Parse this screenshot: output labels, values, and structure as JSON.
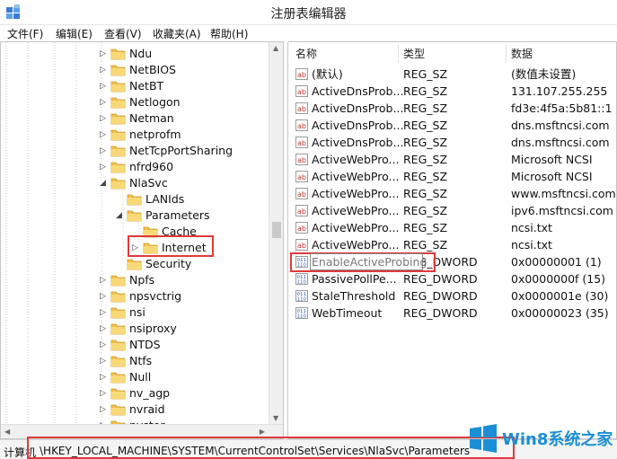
{
  "window": {
    "title": "注册表编辑器"
  },
  "menu": [
    {
      "label": "文件(F)"
    },
    {
      "label": "编辑(E)"
    },
    {
      "label": "查看(V)"
    },
    {
      "label": "收藏夹(A)"
    },
    {
      "label": "帮助(H)"
    }
  ],
  "tree": {
    "nodes": [
      {
        "label": "Ndu",
        "level": 0,
        "expander": "▷"
      },
      {
        "label": "NetBIOS",
        "level": 0,
        "expander": "▷"
      },
      {
        "label": "NetBT",
        "level": 0,
        "expander": "▷"
      },
      {
        "label": "Netlogon",
        "level": 0,
        "expander": "▷"
      },
      {
        "label": "Netman",
        "level": 0,
        "expander": "▷"
      },
      {
        "label": "netprofm",
        "level": 0,
        "expander": "▷"
      },
      {
        "label": "NetTcpPortSharing",
        "level": 0,
        "expander": "▷"
      },
      {
        "label": "nfrd960",
        "level": 0,
        "expander": "▷"
      },
      {
        "label": "NlaSvc",
        "level": 0,
        "expander": "◢"
      },
      {
        "label": "LANIds",
        "level": 1,
        "expander": ""
      },
      {
        "label": "Parameters",
        "level": 1,
        "expander": "◢"
      },
      {
        "label": "Cache",
        "level": 2,
        "expander": ""
      },
      {
        "label": "Internet",
        "level": 2,
        "expander": "▷",
        "selected": true
      },
      {
        "label": "Security",
        "level": 1,
        "expander": ""
      },
      {
        "label": "Npfs",
        "level": 0,
        "expander": "▷"
      },
      {
        "label": "npsvctrig",
        "level": 0,
        "expander": "▷"
      },
      {
        "label": "nsi",
        "level": 0,
        "expander": "▷"
      },
      {
        "label": "nsiproxy",
        "level": 0,
        "expander": "▷"
      },
      {
        "label": "NTDS",
        "level": 0,
        "expander": "▷"
      },
      {
        "label": "Ntfs",
        "level": 0,
        "expander": "▷"
      },
      {
        "label": "Null",
        "level": 0,
        "expander": "▷"
      },
      {
        "label": "nv_agp",
        "level": 0,
        "expander": "▷"
      },
      {
        "label": "nvraid",
        "level": 0,
        "expander": "▷"
      },
      {
        "label": "nvstor",
        "level": 0,
        "expander": "▷"
      }
    ]
  },
  "list": {
    "columns": [
      "名称",
      "类型",
      "数据"
    ],
    "rows": [
      {
        "name": "(默认)",
        "type": "REG_SZ",
        "data": "(数值未设置)",
        "icon": "string-value-icon"
      },
      {
        "name": "ActiveDnsProb...",
        "type": "REG_SZ",
        "data": "131.107.255.255",
        "icon": "string-value-icon"
      },
      {
        "name": "ActiveDnsProb...",
        "type": "REG_SZ",
        "data": "fd3e:4f5a:5b81::1",
        "icon": "string-value-icon"
      },
      {
        "name": "ActiveDnsProb...",
        "type": "REG_SZ",
        "data": "dns.msftncsi.com",
        "icon": "string-value-icon"
      },
      {
        "name": "ActiveDnsProb...",
        "type": "REG_SZ",
        "data": "dns.msftncsi.com",
        "icon": "string-value-icon"
      },
      {
        "name": "ActiveWebPro...",
        "type": "REG_SZ",
        "data": "Microsoft NCSI",
        "icon": "string-value-icon"
      },
      {
        "name": "ActiveWebPro...",
        "type": "REG_SZ",
        "data": "Microsoft NCSI",
        "icon": "string-value-icon"
      },
      {
        "name": "ActiveWebPro...",
        "type": "REG_SZ",
        "data": "www.msftncsi.com",
        "icon": "string-value-icon"
      },
      {
        "name": "ActiveWebPro...",
        "type": "REG_SZ",
        "data": "ipv6.msftncsi.com",
        "icon": "string-value-icon"
      },
      {
        "name": "ActiveWebPro...",
        "type": "REG_SZ",
        "data": "ncsi.txt",
        "icon": "string-value-icon"
      },
      {
        "name": "ActiveWebPro...",
        "type": "REG_SZ",
        "data": "ncsi.txt",
        "icon": "string-value-icon"
      },
      {
        "name": "EnableActiveProbing",
        "type": "REG_DWORD",
        "data": "0x00000001 (1)",
        "icon": "binary-value-icon",
        "editing": true
      },
      {
        "name": "PassivePollPe...",
        "type": "REG_DWORD",
        "data": "0x0000000f (15)",
        "icon": "binary-value-icon"
      },
      {
        "name": "StaleThreshold",
        "type": "REG_DWORD",
        "data": "0x0000001e (30)",
        "icon": "binary-value-icon"
      },
      {
        "name": "WebTimeout",
        "type": "REG_DWORD",
        "data": "0x00000023 (35)",
        "icon": "binary-value-icon"
      }
    ]
  },
  "status": {
    "prefix": "计算机",
    "path": "\\HKEY_LOCAL_MACHINE\\SYSTEM\\CurrentControlSet\\Services\\NlaSvc\\Parameters"
  },
  "watermark": {
    "text": "Win8系统之家"
  },
  "colors": {
    "highlight": "#e03a3a",
    "folder": "#f2c14e",
    "value_icon_blue": "#2a5bb8",
    "watermark": "#1b8fd6"
  }
}
